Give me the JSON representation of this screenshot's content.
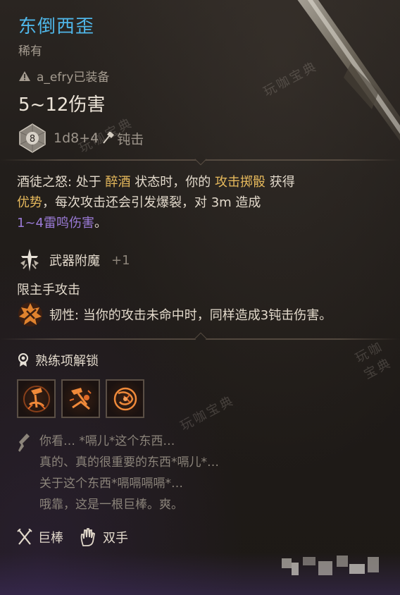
{
  "item": {
    "name": "东倒西歪",
    "rarity": "稀有",
    "equipped_text": "a_efry已装备",
    "damage": "5~12伤害",
    "dice_value": "8",
    "dice_text": "1d8+4",
    "damage_type": "钝击"
  },
  "passive": {
    "name": "酒徒之怒:",
    "text_1": " 处于 ",
    "kw_drunk": "醉酒",
    "text_2": " 状态时，你的 ",
    "kw_attack_roll": "攻击掷骰",
    "text_3": " 获得",
    "kw_advantage": "优势",
    "text_4": "，每次攻击还会引发爆裂，对 3m 造成",
    "kw_thunder": "1~4雷鸣伤害",
    "text_5": "。"
  },
  "enchant": {
    "label": "武器附魔",
    "bonus": "+1"
  },
  "mainhand_only": "限主手攻击",
  "tough": {
    "name": "韧性:",
    "text": " 当你的攻击未命中时，同样造成3钝击伤害。"
  },
  "proficiency": {
    "title": "熟练项解锁",
    "icons": [
      "topple-icon",
      "weakening-strike-icon",
      "concussive-smash-icon"
    ]
  },
  "flavor": [
    "你看… *嗝儿*这个东西…",
    "真的、真的很重要的东西*嗝儿*…",
    "关于这个东西*嗝嗝嗝嗝*…",
    "哦靠，这是一根巨棒。爽。"
  ],
  "footer": {
    "weapon_type": "巨棒",
    "handedness": "双手"
  },
  "watermark": "玩咖宝典",
  "colors": {
    "name": "#4fb6e8",
    "keyword": "#e6b95c",
    "thunder": "#9a7ad6"
  }
}
